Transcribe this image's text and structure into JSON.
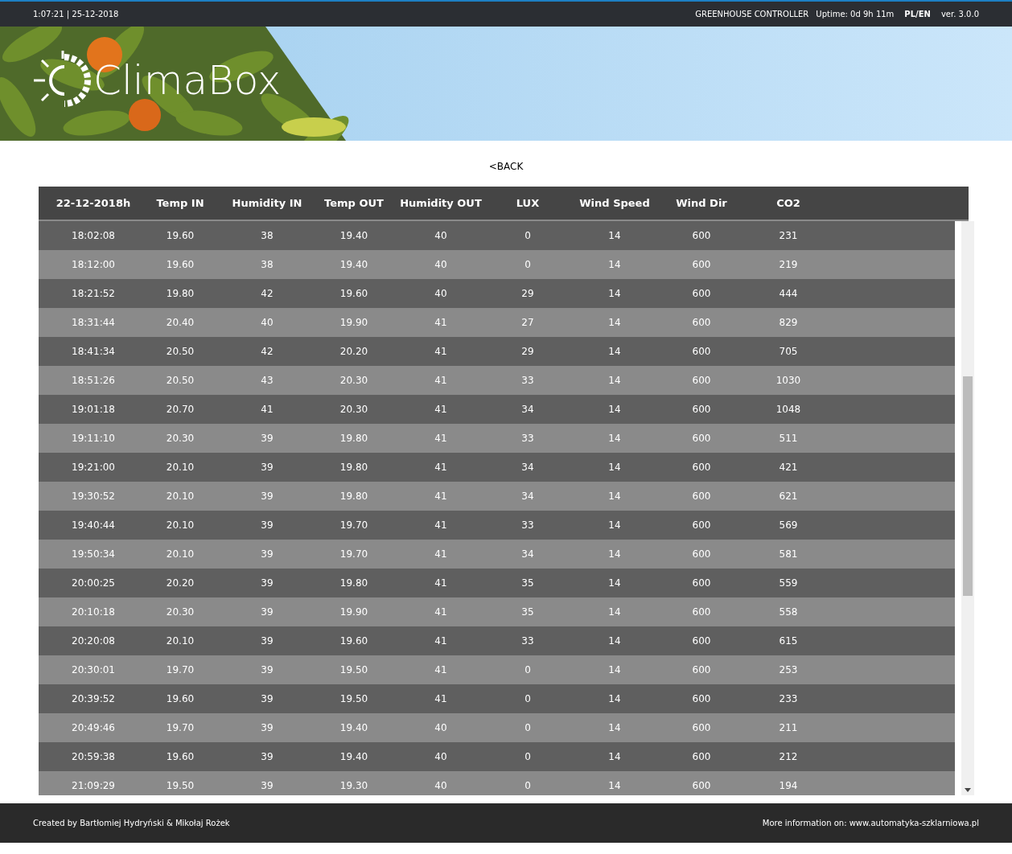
{
  "top_bar": {
    "datetime": "1:07:21 | 25-12-2018",
    "title": "GREENHOUSE CONTROLLER",
    "uptime": "Uptime: 0d 9h 11m",
    "language": "PL/EN",
    "version": "ver. 3.0.0"
  },
  "banner": {
    "kind": "picture",
    "logo_text": "ClimaBox"
  },
  "back_link": "<BACK",
  "table": {
    "columns": [
      "22-12-2018h",
      "Temp IN",
      "Humidity IN",
      "Temp OUT",
      "Humidity OUT",
      "LUX",
      "Wind Speed",
      "Wind Dir",
      "CO2"
    ],
    "rows": [
      [
        "18:02:08",
        "19.60",
        "38",
        "19.40",
        "40",
        "0",
        "14",
        "600",
        "231"
      ],
      [
        "18:12:00",
        "19.60",
        "38",
        "19.40",
        "40",
        "0",
        "14",
        "600",
        "219"
      ],
      [
        "18:21:52",
        "19.80",
        "42",
        "19.60",
        "40",
        "29",
        "14",
        "600",
        "444"
      ],
      [
        "18:31:44",
        "20.40",
        "40",
        "19.90",
        "41",
        "27",
        "14",
        "600",
        "829"
      ],
      [
        "18:41:34",
        "20.50",
        "42",
        "20.20",
        "41",
        "29",
        "14",
        "600",
        "705"
      ],
      [
        "18:51:26",
        "20.50",
        "43",
        "20.30",
        "41",
        "33",
        "14",
        "600",
        "1030"
      ],
      [
        "19:01:18",
        "20.70",
        "41",
        "20.30",
        "41",
        "34",
        "14",
        "600",
        "1048"
      ],
      [
        "19:11:10",
        "20.30",
        "39",
        "19.80",
        "41",
        "33",
        "14",
        "600",
        "511"
      ],
      [
        "19:21:00",
        "20.10",
        "39",
        "19.80",
        "41",
        "34",
        "14",
        "600",
        "421"
      ],
      [
        "19:30:52",
        "20.10",
        "39",
        "19.80",
        "41",
        "34",
        "14",
        "600",
        "621"
      ],
      [
        "19:40:44",
        "20.10",
        "39",
        "19.70",
        "41",
        "33",
        "14",
        "600",
        "569"
      ],
      [
        "19:50:34",
        "20.10",
        "39",
        "19.70",
        "41",
        "34",
        "14",
        "600",
        "581"
      ],
      [
        "20:00:25",
        "20.20",
        "39",
        "19.80",
        "41",
        "35",
        "14",
        "600",
        "559"
      ],
      [
        "20:10:18",
        "20.30",
        "39",
        "19.90",
        "41",
        "35",
        "14",
        "600",
        "558"
      ],
      [
        "20:20:08",
        "20.10",
        "39",
        "19.60",
        "41",
        "33",
        "14",
        "600",
        "615"
      ],
      [
        "20:30:01",
        "19.70",
        "39",
        "19.50",
        "41",
        "0",
        "14",
        "600",
        "253"
      ],
      [
        "20:39:52",
        "19.60",
        "39",
        "19.50",
        "41",
        "0",
        "14",
        "600",
        "233"
      ],
      [
        "20:49:46",
        "19.70",
        "39",
        "19.40",
        "40",
        "0",
        "14",
        "600",
        "211"
      ],
      [
        "20:59:38",
        "19.60",
        "39",
        "19.40",
        "40",
        "0",
        "14",
        "600",
        "212"
      ],
      [
        "21:09:29",
        "19.50",
        "39",
        "19.30",
        "40",
        "0",
        "14",
        "600",
        "194"
      ]
    ]
  },
  "footer": {
    "credits": "Created by Bartłomiej Hydryński & Mikołaj Rożek",
    "more_info": "More information on: www.automatyka-szklarniowa.pl"
  }
}
